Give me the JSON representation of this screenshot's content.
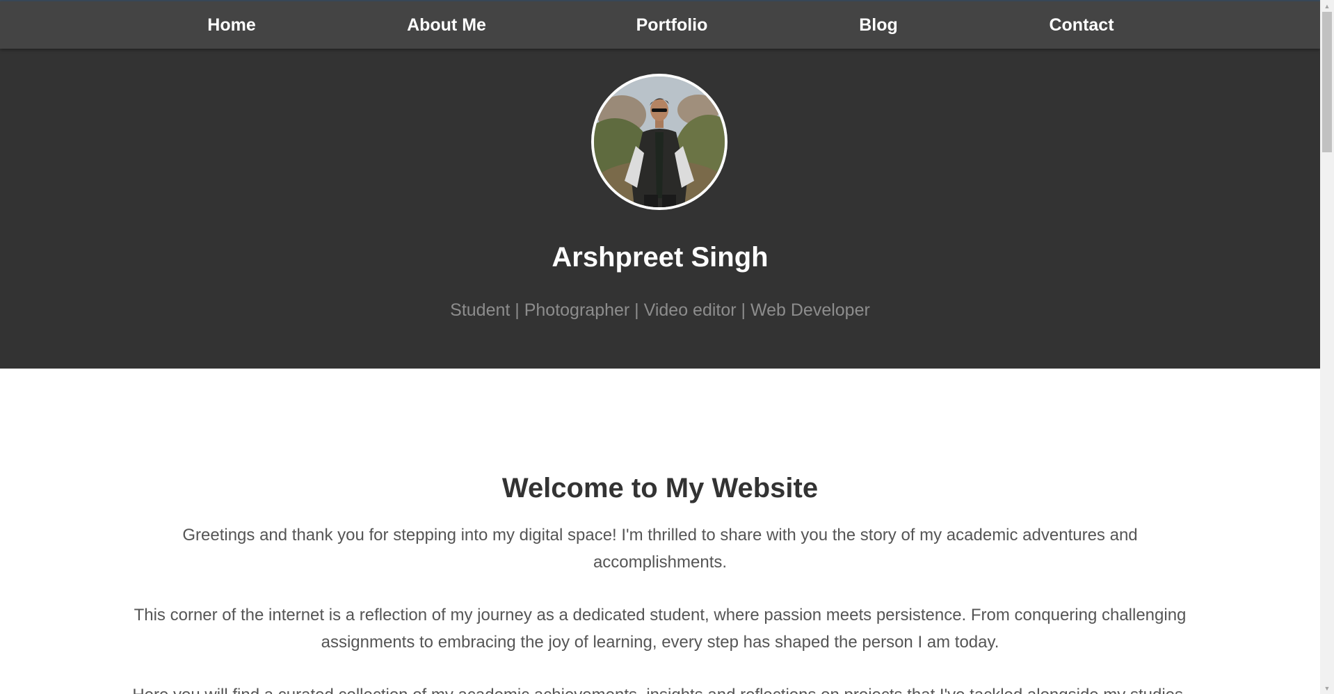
{
  "nav": {
    "items": [
      {
        "label": "Home"
      },
      {
        "label": "About Me"
      },
      {
        "label": "Portfolio"
      },
      {
        "label": "Blog"
      },
      {
        "label": "Contact"
      }
    ]
  },
  "hero": {
    "name": "Arshpreet Singh",
    "tagline": "Student | Photographer | Video editor | Web Developer",
    "avatar_icon": "profile-photo"
  },
  "main": {
    "title": "Welcome to My Website",
    "paragraphs": [
      "Greetings and thank you for stepping into my digital space! I'm thrilled to share with you the story of my academic adventures and accomplishments.",
      "This corner of the internet is a reflection of my journey as a dedicated student, where passion meets persistence. From conquering challenging assignments to embracing the joy of learning, every step has shaped the person I am today.",
      "Here you will find a curated collection of my academic achievements, insights and reflections on projects that I've tackled alongside my studies."
    ]
  },
  "colors": {
    "nav_bg": "#444444",
    "hero_bg": "#333333",
    "text_primary": "#333333",
    "text_body": "#555555",
    "tagline": "#8d8d8d"
  },
  "scrollbar": {
    "up_icon": "scroll-up-arrow",
    "down_icon": "scroll-down-arrow",
    "position": 0.0
  }
}
